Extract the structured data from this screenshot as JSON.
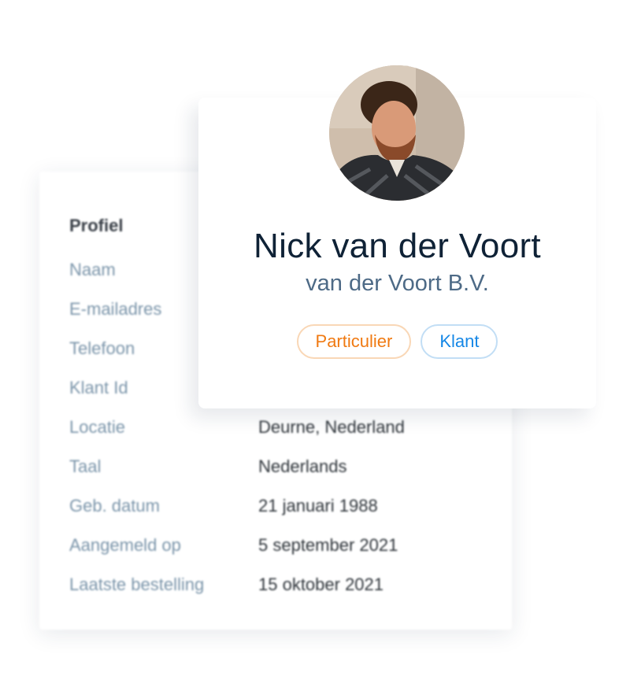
{
  "profile": {
    "heading": "Profiel",
    "fields": [
      {
        "label": "Naam",
        "value": ""
      },
      {
        "label": "E-mailadres",
        "value": ""
      },
      {
        "label": "Telefoon",
        "value": ""
      },
      {
        "label": "Klant Id",
        "value": ""
      },
      {
        "label": "Locatie",
        "value": "Deurne, Nederland"
      },
      {
        "label": "Taal",
        "value": "Nederlands"
      },
      {
        "label": "Geb. datum",
        "value": "21 januari 1988"
      },
      {
        "label": "Aangemeld op",
        "value": "5 september 2021"
      },
      {
        "label": "Laatste bestelling",
        "value": "15 oktober 2021"
      }
    ]
  },
  "card": {
    "name": "Nick van der Voort",
    "company": "van der Voort B.V.",
    "badges": [
      {
        "label": "Particulier",
        "color": "#f07a12"
      },
      {
        "label": "Klant",
        "color": "#1587e6"
      }
    ]
  }
}
